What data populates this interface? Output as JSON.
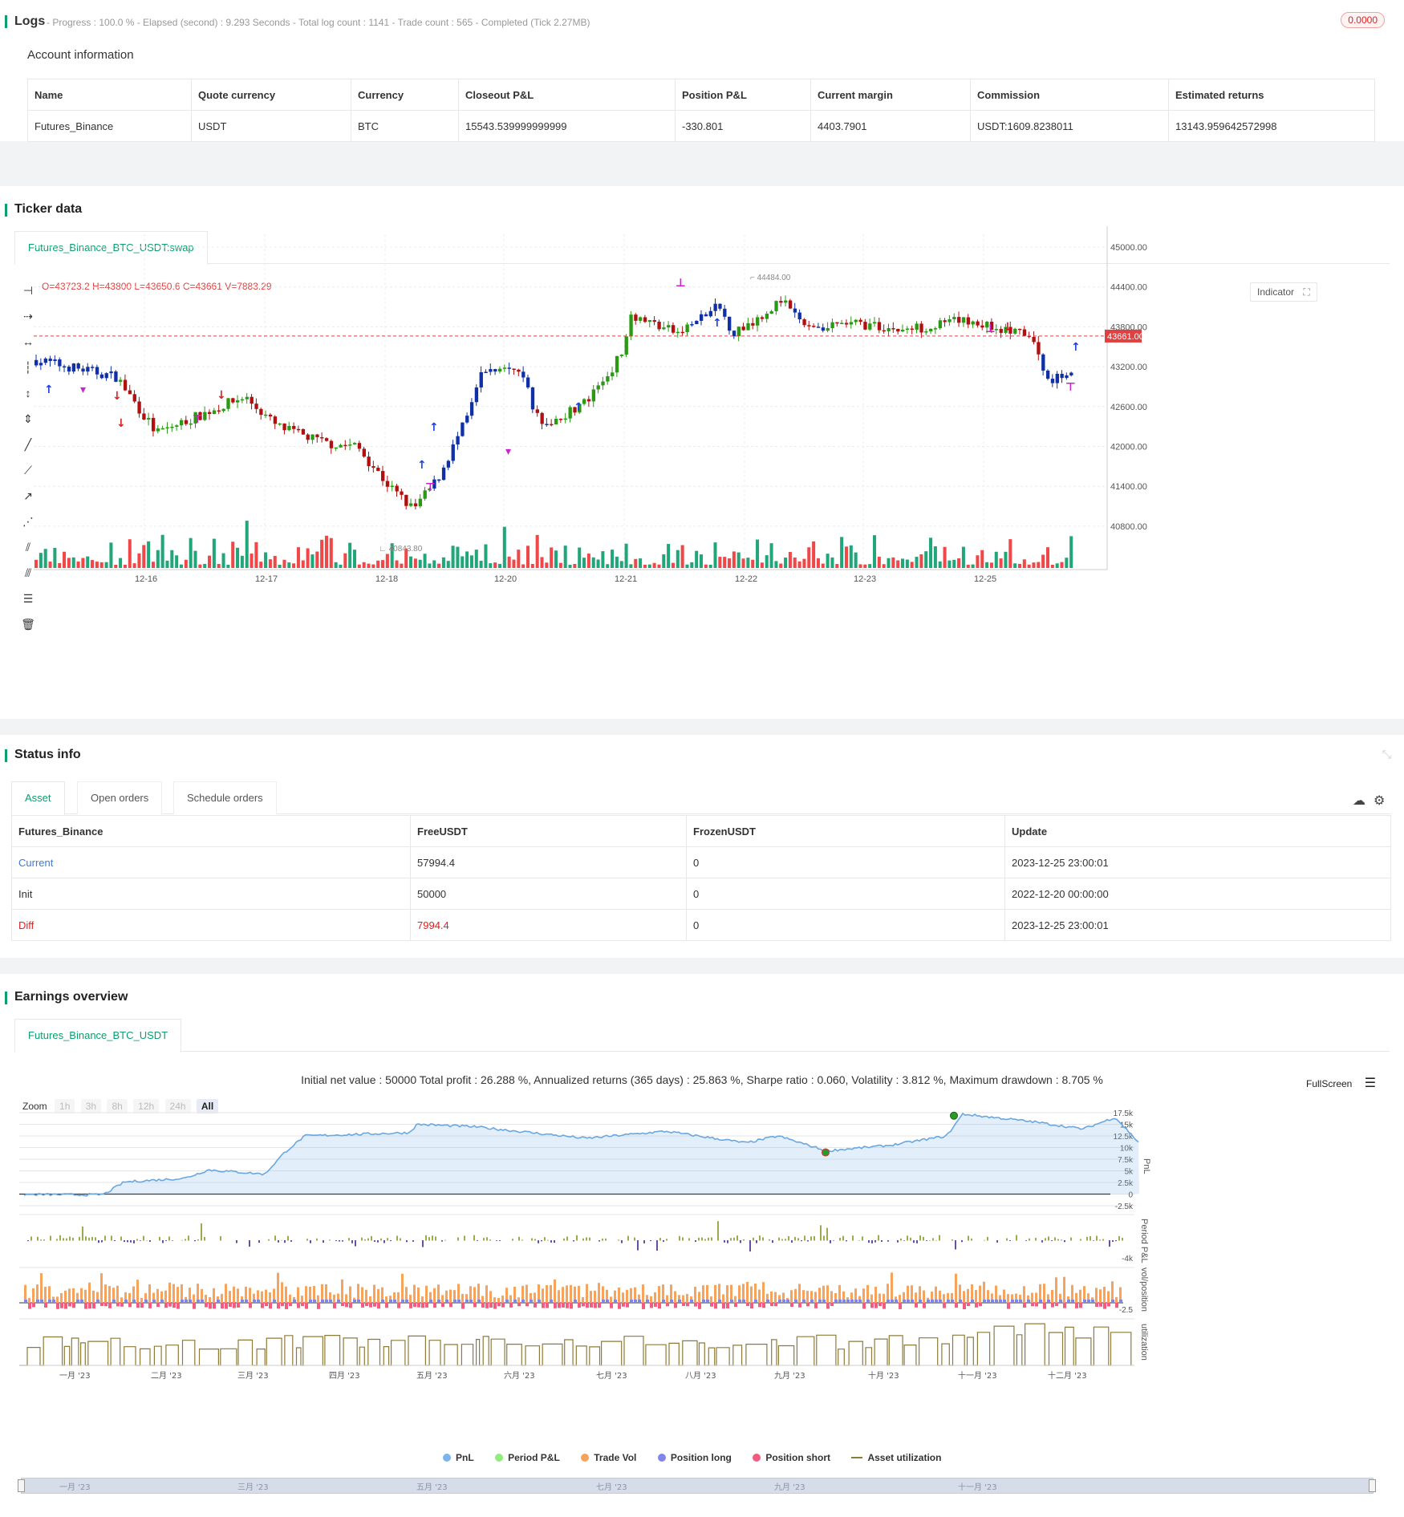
{
  "logs": {
    "title": "Logs",
    "summary": "- Progress : 100.0 % - Elapsed (second) : 9.293 Seconds - Total log count : 1141 - Trade count : 565 - Completed (Tick 2.27MB)",
    "badge": "0.0000"
  },
  "account": {
    "title": "Account information",
    "headers": [
      "Name",
      "Quote currency",
      "Currency",
      "Closeout P&L",
      "Position P&L",
      "Current margin",
      "Commission",
      "Estimated returns"
    ],
    "row": [
      "Futures_Binance",
      "USDT",
      "BTC",
      "15543.539999999999",
      "-330.801",
      "4403.7901",
      "USDT:1609.8238011",
      "13143.959642572998"
    ]
  },
  "ticker": {
    "title": "Ticker data",
    "tab": "Futures_Binance_BTC_USDT:swap",
    "ohlc": "O=43723.2 H=43800 L=43650.6 C=43661 V=7883.29",
    "indicator_label": "Indicator",
    "price_ticks": [
      "45000.00",
      "44400.00",
      "43800.00",
      "43200.00",
      "42600.00",
      "42000.00",
      "41400.00",
      "40800.00"
    ],
    "date_ticks": [
      "12-16",
      "12-17",
      "12-18",
      "12-20",
      "12-21",
      "12-22",
      "12-23",
      "12-25"
    ],
    "current_price": "43661.00",
    "high_label": "44484.00",
    "low_label": "40843.80",
    "colors": {
      "up": "#2a9a14",
      "down": "#b01010",
      "blue": "#1030a8",
      "signal": "#cc22cc",
      "vol_up": "#21a67a",
      "vol_down": "#f04848"
    }
  },
  "status": {
    "title": "Status info",
    "tabs": [
      "Asset",
      "Open orders",
      "Schedule orders"
    ],
    "headers": [
      "Futures_Binance",
      "FreeUSDT",
      "FrozenUSDT",
      "Update"
    ],
    "rows": [
      [
        "Current",
        "57994.4",
        "0",
        "2023-12-25 23:00:01"
      ],
      [
        "Init",
        "50000",
        "0",
        "2022-12-20 00:00:00"
      ],
      [
        "Diff",
        "7994.4",
        "0",
        "2023-12-25 23:00:01"
      ]
    ]
  },
  "earnings": {
    "title": "Earnings overview",
    "tab": "Futures_Binance_BTC_USDT",
    "summary": "Initial net value : 50000 Total profit : 26.288 %, Annualized returns (365 days) : 25.863 %, Sharpe ratio : 0.060, Volatility : 3.812 %, Maximum drawdown : 8.705 %",
    "fullscreen": "FullScreen",
    "zoom_label": "Zoom",
    "zoom_buttons": [
      "1h",
      "3h",
      "8h",
      "12h",
      "24h",
      "All"
    ],
    "pnl_ticks": [
      "17.5k",
      "15k",
      "12.5k",
      "10k",
      "7.5k",
      "5k",
      "2.5k",
      "0",
      "-2.5k"
    ],
    "pnl_axis": "PnL",
    "period_axis": "Period P&L",
    "period_tick": "-4k",
    "vol_axis": "vol/position",
    "vol_tick": "-2.5",
    "util_axis": "utilization",
    "months": [
      "一月 '23",
      "二月 '23",
      "三月 '23",
      "四月 '23",
      "五月 '23",
      "六月 '23",
      "七月 '23",
      "八月 '23",
      "九月 '23",
      "十月 '23",
      "十一月 '23",
      "十二月 '23"
    ],
    "nav_months": [
      "一月 '23",
      "三月 '23",
      "五月 '23",
      "七月 '23",
      "九月 '23",
      "十一月 '23"
    ],
    "legend": [
      {
        "name": "PnL",
        "color": "#7cb5ec"
      },
      {
        "name": "Period P&L",
        "color": "#90ed7d"
      },
      {
        "name": "Trade Vol",
        "color": "#f7a35c"
      },
      {
        "name": "Position long",
        "color": "#8085e9"
      },
      {
        "name": "Position short",
        "color": "#f15c80"
      },
      {
        "name": "Asset utilization",
        "color": "#8d7b3a"
      }
    ]
  }
}
